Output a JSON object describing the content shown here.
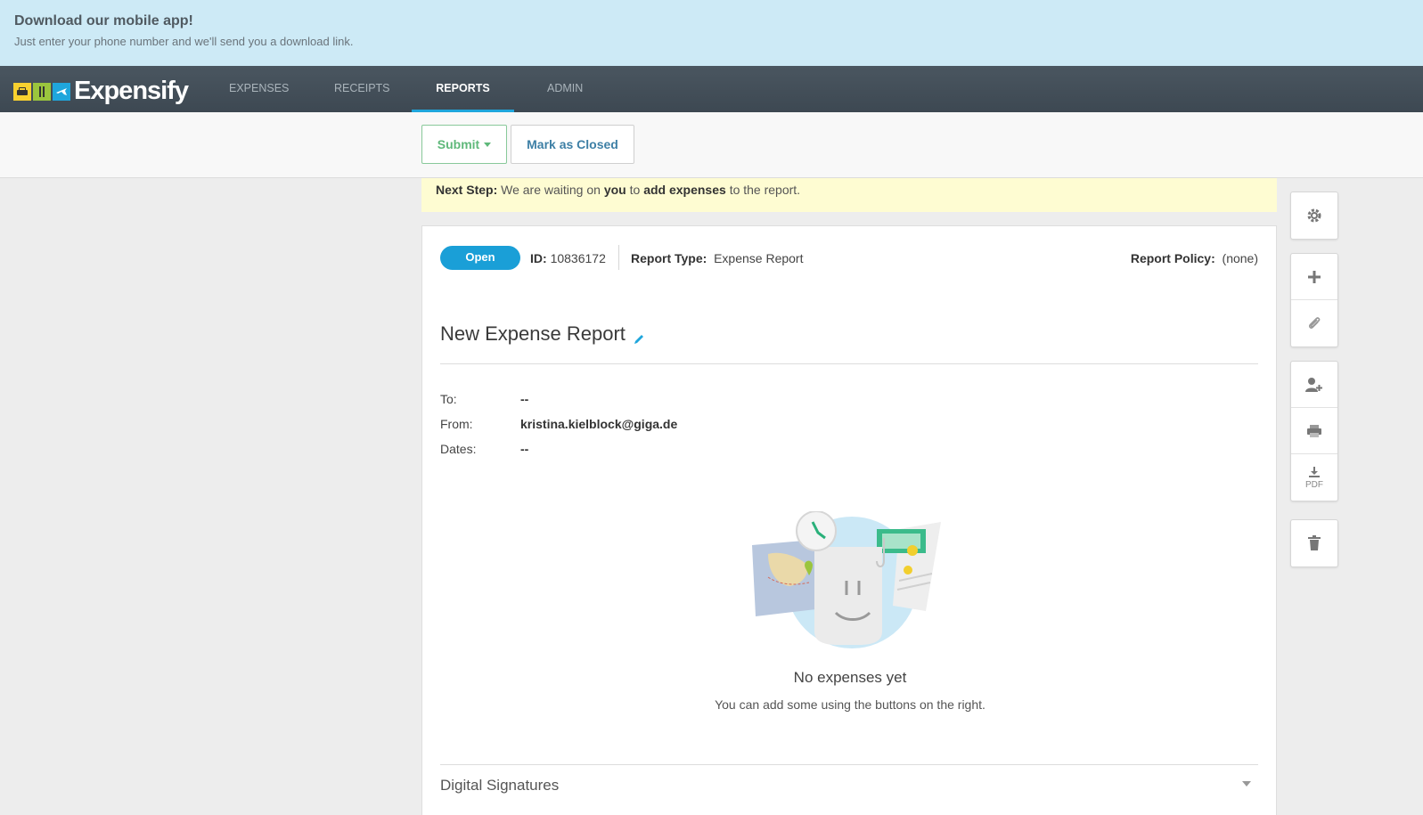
{
  "banner": {
    "title": "Download our mobile app!",
    "subtitle": "Just enter your phone number and we'll send you a download link."
  },
  "nav": {
    "logo_text": "Expensify",
    "items": [
      {
        "label": "EXPENSES",
        "active": false
      },
      {
        "label": "RECEIPTS",
        "active": false
      },
      {
        "label": "REPORTS",
        "active": true
      },
      {
        "label": "ADMIN",
        "active": false
      }
    ]
  },
  "toolbar": {
    "submit_label": "Submit",
    "mark_closed_label": "Mark as Closed"
  },
  "next_step": {
    "label": "Next Step:",
    "text_1": "We are waiting on",
    "who": "you",
    "text_2": "to",
    "action": "add expenses",
    "text_3": "to the report."
  },
  "report": {
    "status": "Open",
    "id_label": "ID:",
    "id_value": "10836172",
    "type_label": "Report Type:",
    "type_value": "Expense Report",
    "policy_label": "Report Policy:",
    "policy_value": "(none)",
    "title": "New Expense Report",
    "to_label": "To:",
    "to_value": "--",
    "from_label": "From:",
    "from_value": "kristina.kielblock@giga.de",
    "dates_label": "Dates:",
    "dates_value": "--",
    "empty_title": "No expenses yet",
    "empty_subtitle": "You can add some using the buttons on the right.",
    "signatures_label": "Digital Signatures"
  },
  "sidebar": {
    "pdf_label": "PDF",
    "icons": [
      "gear-icon",
      "plus-icon",
      "paperclip-icon",
      "add-user-icon",
      "print-icon",
      "download-pdf-icon",
      "trash-icon"
    ]
  },
  "colors": {
    "banner_bg": "#cdeaf6",
    "nav_bg": "#434f59",
    "accent_blue": "#1fa6dc",
    "submit_green": "#5fb87a",
    "next_step_bg": "#fefcd2"
  }
}
